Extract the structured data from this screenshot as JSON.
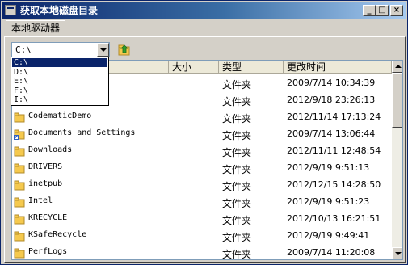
{
  "window": {
    "title": "获取本地磁盘目录",
    "minimize": "_",
    "maximize": "□",
    "close": "×"
  },
  "tab": {
    "label": "本地驱动器"
  },
  "drive_combo": {
    "value": "C:\\"
  },
  "drive_options": [
    "C:\\",
    "D:\\",
    "E:\\",
    "F:\\",
    "I:\\"
  ],
  "columns": {
    "name": "",
    "size": "大小",
    "type": "类型",
    "modified": "更改时间"
  },
  "rows": [
    {
      "name": "",
      "type": "文件夹",
      "modified": "2009/7/14 10:34:39",
      "icon": "folder"
    },
    {
      "name": "",
      "type": "文件夹",
      "modified": "2012/9/18 23:26:13",
      "icon": "folder"
    },
    {
      "name": "CodematicDemo",
      "type": "文件夹",
      "modified": "2012/11/14 17:13:24",
      "icon": "folder"
    },
    {
      "name": "Documents and Settings",
      "type": "文件夹",
      "modified": "2009/7/14 13:06:44",
      "icon": "shortcut-folder"
    },
    {
      "name": "Downloads",
      "type": "文件夹",
      "modified": "2012/11/11 12:48:54",
      "icon": "folder"
    },
    {
      "name": "DRIVERS",
      "type": "文件夹",
      "modified": "2012/9/19 9:51:13",
      "icon": "folder"
    },
    {
      "name": "inetpub",
      "type": "文件夹",
      "modified": "2012/12/15 14:28:50",
      "icon": "folder"
    },
    {
      "name": "Intel",
      "type": "文件夹",
      "modified": "2012/9/19 9:51:23",
      "icon": "folder"
    },
    {
      "name": "KRECYCLE",
      "type": "文件夹",
      "modified": "2012/10/13 16:21:51",
      "icon": "folder"
    },
    {
      "name": "KSafeRecycle",
      "type": "文件夹",
      "modified": "2012/9/19 9:49:41",
      "icon": "folder"
    },
    {
      "name": "PerfLogs",
      "type": "文件夹",
      "modified": "2009/7/14 11:20:08",
      "icon": "folder"
    }
  ],
  "colors": {
    "title_start": "#0a246a",
    "title_end": "#a6caf0",
    "selection": "#0a246a",
    "folder": "#f5c94e"
  }
}
